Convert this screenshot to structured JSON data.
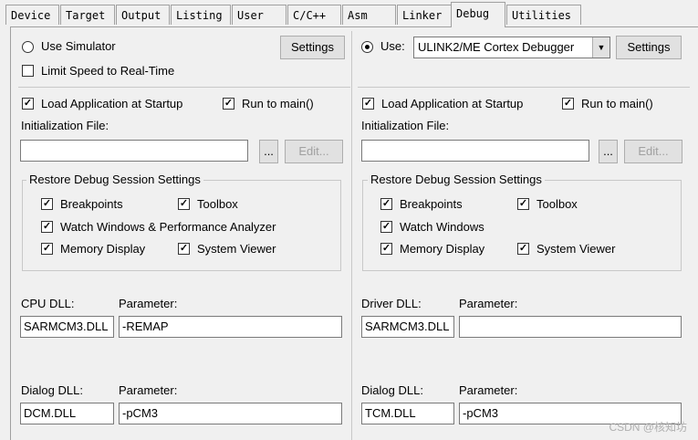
{
  "tabs": [
    {
      "label": "Device"
    },
    {
      "label": "Target"
    },
    {
      "label": "Output"
    },
    {
      "label": "Listing"
    },
    {
      "label": "User"
    },
    {
      "label": "C/C++"
    },
    {
      "label": "Asm"
    },
    {
      "label": "Linker"
    },
    {
      "label": "Debug"
    },
    {
      "label": "Utilities"
    }
  ],
  "left": {
    "use_simulator": "Use Simulator",
    "limit_speed": "Limit Speed to Real-Time",
    "settings": "Settings",
    "load_app": "Load Application at Startup",
    "run_to_main": "Run to main()",
    "init_file_label": "Initialization File:",
    "init_file_value": "",
    "browse": "...",
    "edit": "Edit...",
    "restore_title": "Restore Debug Session Settings",
    "breakpoints": "Breakpoints",
    "toolbox": "Toolbox",
    "watch_windows": "Watch Windows & Performance Analyzer",
    "memory_display": "Memory Display",
    "system_viewer": "System Viewer",
    "cpu_dll_label": "CPU DLL:",
    "cpu_param_label": "Parameter:",
    "cpu_dll_value": "SARMCM3.DLL",
    "cpu_param_value": "-REMAP",
    "dialog_dll_label": "Dialog DLL:",
    "dialog_param_label": "Parameter:",
    "dialog_dll_value": "DCM.DLL",
    "dialog_param_value": "-pCM3"
  },
  "right": {
    "use_label": "Use:",
    "debugger": "ULINK2/ME Cortex Debugger",
    "settings": "Settings",
    "load_app": "Load Application at Startup",
    "run_to_main": "Run to main()",
    "init_file_label": "Initialization File:",
    "init_file_value": "",
    "browse": "...",
    "edit": "Edit...",
    "restore_title": "Restore Debug Session Settings",
    "breakpoints": "Breakpoints",
    "toolbox": "Toolbox",
    "watch_windows": "Watch Windows",
    "memory_display": "Memory Display",
    "system_viewer": "System Viewer",
    "driver_dll_label": "Driver DLL:",
    "driver_param_label": "Parameter:",
    "driver_dll_value": "SARMCM3.DLL",
    "driver_param_value": "",
    "dialog_dll_label": "Dialog DLL:",
    "dialog_param_label": "Parameter:",
    "dialog_dll_value": "TCM.DLL",
    "dialog_param_value": "-pCM3"
  },
  "watermark": "CSDN @核知坊",
  "checkmark": "✓"
}
